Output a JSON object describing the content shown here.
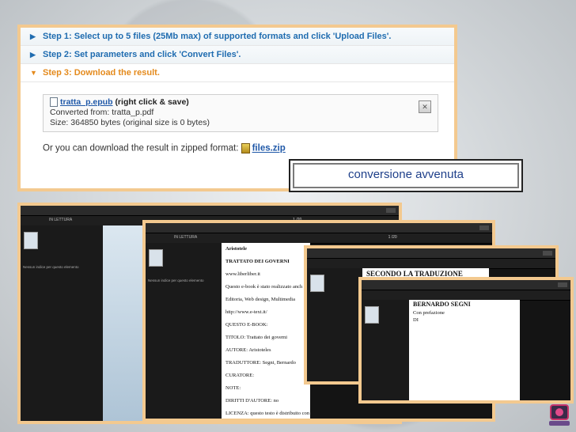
{
  "steps": [
    {
      "label": "Step 1: Select up to 5 files (25Mb max) of supported formats and click 'Upload Files'."
    },
    {
      "label": "Step 2: Set parameters and click 'Convert Files'."
    },
    {
      "label": "Step 3: Download the result."
    }
  ],
  "result": {
    "file_link": "tratta_p.epub",
    "right_click": "(right click & save)",
    "converted_from": "Converted from: tratta_p.pdf",
    "size": "Size: 364850 bytes (original size is 0 bytes)",
    "zip_prefix": "Or you can download the result in zipped format:",
    "zip_link": "files.zip"
  },
  "callout": "conversione avvenuta",
  "reader": {
    "tab": "IN LETTURA",
    "page": "1 /20",
    "no_index": "Nessun indice per questo elemento",
    "doc1_lines": [
      "Aristotele",
      "TRATTATO DEI GOVERNI",
      "www.liberliber.it",
      "Questo e-book è stato realizzato anch",
      "Editoria, Web design, Multimedia",
      "http://www.e-text.it/",
      "QUESTO E-BOOK:",
      "TITOLO: Trattato dei governi",
      "AUTORE: Aristoteles",
      "TRADUTTORE: Segni, Bernardo",
      "CURATORE:",
      "NOTE:",
      "DIRITTI D'AUTORE: no",
      "LICENZA: questo testo è distribuito con la licenza"
    ],
    "doc2_title": "SECONDO LA TRADUZIONE",
    "doc2_sub": "DI",
    "doc3_title": "BERNARDO SEGNI",
    "doc3_lines": [
      "Con prefazione",
      "DI"
    ]
  },
  "colors": {
    "step_blue": "#1f6cb0",
    "step_orange": "#e48a1c",
    "frame": "#f3c98f"
  }
}
